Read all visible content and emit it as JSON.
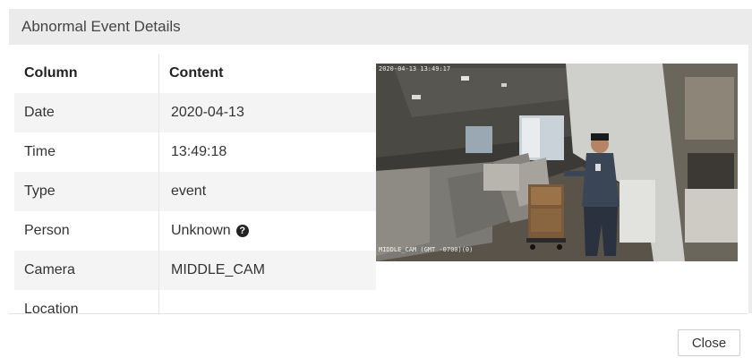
{
  "dialog": {
    "title": "Abnormal Event Details"
  },
  "table": {
    "headers": {
      "column": "Column",
      "content": "Content"
    },
    "rows": [
      {
        "label": "Date",
        "value": "2020-04-13"
      },
      {
        "label": "Time",
        "value": "13:49:18"
      },
      {
        "label": "Type",
        "value": "event"
      },
      {
        "label": "Person",
        "value": "Unknown",
        "icon": "question-circle-icon"
      },
      {
        "label": "Camera",
        "value": "MIDDLE_CAM"
      },
      {
        "label": "Location",
        "value": ""
      }
    ]
  },
  "snapshot": {
    "timestamp_overlay": "2020-04-13 13:49:17",
    "camera_overlay": "MIDDLE_CAM  (GMT -0700)(0)"
  },
  "footer": {
    "close_label": "Close"
  }
}
